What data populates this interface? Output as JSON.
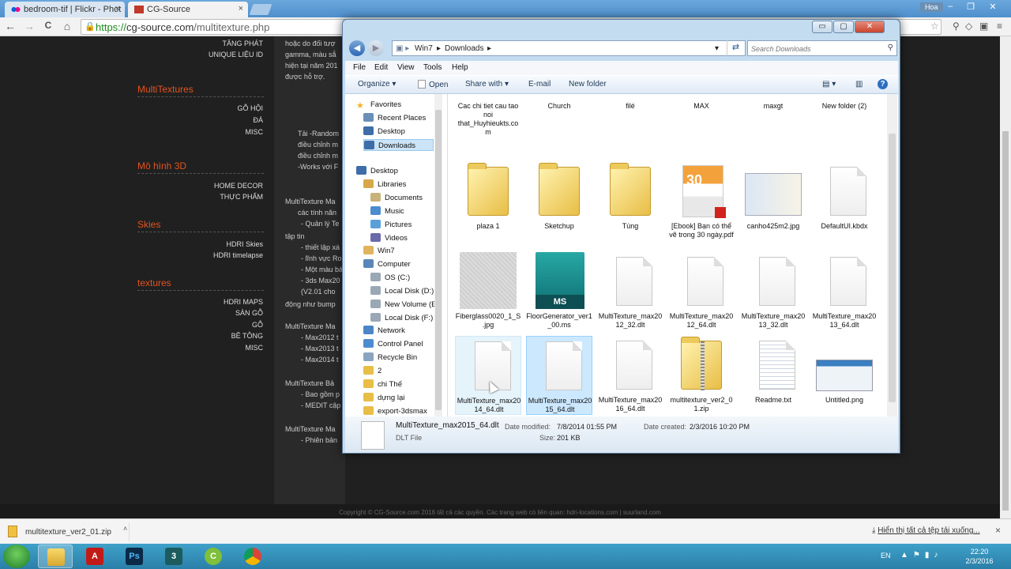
{
  "browser": {
    "tabs": [
      {
        "title": "bedroom-tif | Flickr - Phot",
        "close": "×"
      },
      {
        "title": "CG-Source",
        "close": "×"
      }
    ],
    "user": "Hoa",
    "url_prefix": "https://",
    "url_domain": "cg-source.com",
    "url_path": "/multitexture.php",
    "nav": {
      "back": "←",
      "forward": "→",
      "reload": "C",
      "home": "⌂"
    }
  },
  "website": {
    "top_items": [
      "TĂNG PHÁT",
      "UNIQUE LIỆU ID"
    ],
    "sections": [
      {
        "title": "MultiTextures",
        "items": [
          "GỖ HỘI",
          "ĐÁ",
          "MISC"
        ]
      },
      {
        "title": "Mô hình 3D",
        "items": [
          "HOME DECOR",
          "THỰC PHẨM"
        ]
      },
      {
        "title": "Skies",
        "items": [
          "HDRI Skies",
          "HDRI timelapse"
        ]
      },
      {
        "title": "textures",
        "items": [
          "HDRI MAPS",
          "SÀN GỖ",
          "GỖ",
          "BÊ TÔNG",
          "MISC"
        ]
      }
    ],
    "content_lines": [
      "hoặc do đối tượ",
      "gamma, màu sắ",
      "hiện tại năm 201",
      "được hỗ trợ.",
      "Tải -Random",
      "điều chỉnh m",
      "điều chỉnh m",
      "-Works với F",
      "MultiTexture Ma",
      "các tính năn",
      "- Quản lý Te",
      "tập tin",
      "- thiết lập xá",
      "- lĩnh vực Ro",
      "- Một màu bả",
      "- 3ds Max20",
      "(V2.01 cho",
      "động như bump",
      "MultiTexture Ma",
      "- Max2012 t",
      "- Max2013 t",
      "- Max2014 t",
      "MultiTexture Bả",
      "- Bao gồm p",
      "- MEDIT cập",
      "MultiTexture Ma",
      "- Phiên bản"
    ],
    "footer": "Copyright © CG-Source.com 2016 tất cả các quyền. Các trang web có liên quan: hdri-locations.com | suurland.com"
  },
  "download_bar": {
    "file": "multitexture_ver2_01.zip",
    "caret": "˄",
    "show_all": "Hiển thị tất cả tệp tải xuống...",
    "close": "×"
  },
  "taskbar": {
    "apps": [
      "explorer",
      "acrobat",
      "photoshop",
      "3dsmax",
      "corel",
      "chrome"
    ],
    "lang": "EN",
    "time": "22:20",
    "date": "2/3/2016"
  },
  "explorer": {
    "controls": {
      "minimize": "▭",
      "maximize": "▢",
      "close": "✕"
    },
    "breadcrumb": [
      "Win7",
      "Downloads"
    ],
    "search_placeholder": "Search Downloads",
    "menu": [
      "File",
      "Edit",
      "View",
      "Tools",
      "Help"
    ],
    "commands": [
      "Organize ▾",
      "Open",
      "Share with ▾",
      "E-mail",
      "New folder"
    ],
    "nav": [
      {
        "label": "Favorites",
        "icon": "star-icon",
        "level": 0
      },
      {
        "label": "Recent Places",
        "icon": "recent-icon",
        "level": 1
      },
      {
        "label": "Desktop",
        "icon": "desktop-icon",
        "level": 1
      },
      {
        "label": "Downloads",
        "icon": "downloads-icon",
        "level": 1,
        "selected": true
      },
      {
        "label": "Desktop",
        "icon": "desktop-icon",
        "level": 0
      },
      {
        "label": "Libraries",
        "icon": "libraries-icon",
        "level": 1
      },
      {
        "label": "Documents",
        "icon": "documents-icon",
        "level": 2
      },
      {
        "label": "Music",
        "icon": "music-icon",
        "level": 2
      },
      {
        "label": "Pictures",
        "icon": "pictures-icon",
        "level": 2
      },
      {
        "label": "Videos",
        "icon": "videos-icon",
        "level": 2
      },
      {
        "label": "Win7",
        "icon": "user-icon",
        "level": 1
      },
      {
        "label": "Computer",
        "icon": "computer-icon",
        "level": 1
      },
      {
        "label": "OS (C:)",
        "icon": "drive-icon",
        "level": 2
      },
      {
        "label": "Local Disk (D:)",
        "icon": "drive-icon",
        "level": 2
      },
      {
        "label": "New Volume (E",
        "icon": "drive-icon",
        "level": 2
      },
      {
        "label": "Local Disk (F:)",
        "icon": "drive-icon",
        "level": 2
      },
      {
        "label": "Network",
        "icon": "network-icon",
        "level": 1
      },
      {
        "label": "Control Panel",
        "icon": "control-panel-icon",
        "level": 1
      },
      {
        "label": "Recycle Bin",
        "icon": "recycle-bin-icon",
        "level": 1
      },
      {
        "label": "2",
        "icon": "folder-icon",
        "level": 1
      },
      {
        "label": "chi Thế",
        "icon": "folder-icon",
        "level": 1
      },
      {
        "label": "dựng lại",
        "icon": "folder-icon",
        "level": 1
      },
      {
        "label": "export-3dsmax",
        "icon": "folder-icon",
        "level": 1
      }
    ],
    "files": [
      {
        "name": "Cac chi tiet cau tao noi that_Huyhieukts.com",
        "kind": "folder"
      },
      {
        "name": "Church",
        "kind": "folder"
      },
      {
        "name": "filé",
        "kind": "folder"
      },
      {
        "name": "MAX",
        "kind": "folder"
      },
      {
        "name": "maxgt",
        "kind": "folder"
      },
      {
        "name": "New folder (2)",
        "kind": "folder"
      },
      {
        "name": "plaza 1",
        "kind": "folder"
      },
      {
        "name": "Sketchup",
        "kind": "folder"
      },
      {
        "name": "Tùng",
        "kind": "folder"
      },
      {
        "name": "[Ebook] Bạn có thể vẽ trong 30 ngày.pdf",
        "kind": "pdf",
        "cover_text": "30"
      },
      {
        "name": "canho425m2.jpg",
        "kind": "image-plan"
      },
      {
        "name": "DefaultUI.kbdx",
        "kind": "doc"
      },
      {
        "name": "Fiberglass0020_1_S.jpg",
        "kind": "image-texture"
      },
      {
        "name": "FloorGenerator_ver1_00.ms",
        "kind": "ms",
        "badge": "MS"
      },
      {
        "name": "MultiTexture_max2012_32.dlt",
        "kind": "doc"
      },
      {
        "name": "MultiTexture_max2012_64.dlt",
        "kind": "doc"
      },
      {
        "name": "MultiTexture_max2013_32.dlt",
        "kind": "doc"
      },
      {
        "name": "MultiTexture_max2013_64.dlt",
        "kind": "doc"
      },
      {
        "name": "MultiTexture_max2014_64.dlt",
        "kind": "doc",
        "state": "hover"
      },
      {
        "name": "MultiTexture_max2015_64.dlt",
        "kind": "doc",
        "state": "selected"
      },
      {
        "name": "MultiTexture_max2016_64.dlt",
        "kind": "doc"
      },
      {
        "name": "multitexture_ver2_01.zip",
        "kind": "zip"
      },
      {
        "name": "Readme.txt",
        "kind": "txt"
      },
      {
        "name": "Untitled.png",
        "kind": "image-screenshot"
      }
    ],
    "details": {
      "name": "MultiTexture_max2015_64.dlt",
      "type": "DLT File",
      "modified_label": "Date modified:",
      "modified": "7/8/2014 01:55 PM",
      "created_label": "Date created:",
      "created": "2/3/2016 10:20 PM",
      "size_label": "Size:",
      "size": "201 KB"
    }
  },
  "colors": {
    "site_accent": "#e2531f",
    "taskbar": "#2a7fa8",
    "selection": "#cce8ff"
  }
}
